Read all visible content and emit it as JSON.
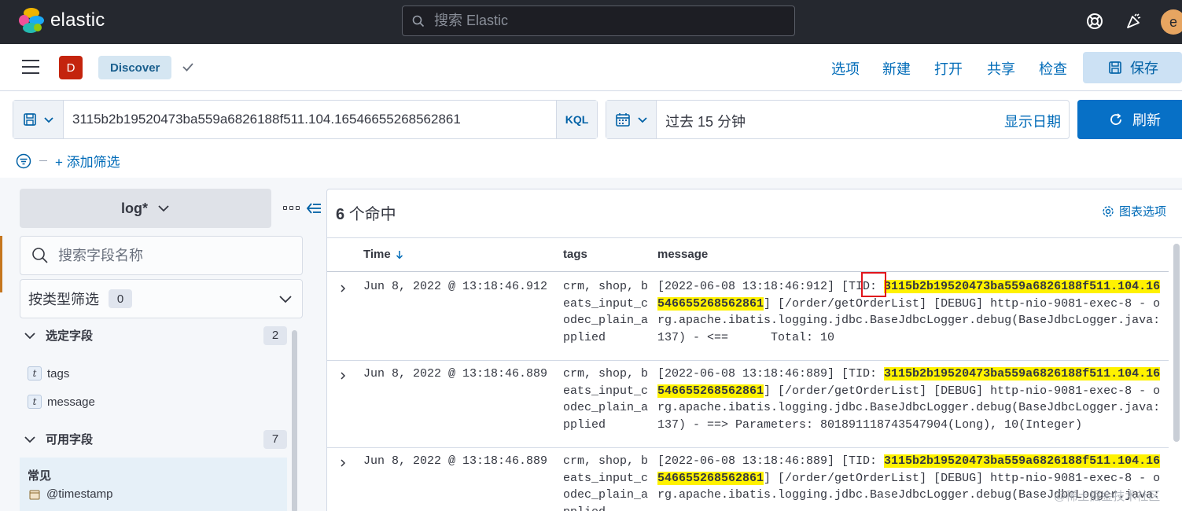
{
  "brand": {
    "name": "elastic"
  },
  "search": {
    "placeholder": "搜索 Elastic"
  },
  "user": {
    "avatar_letter": "e"
  },
  "appbar": {
    "space_letter": "D",
    "breadcrumb": "Discover",
    "nav": [
      "选项",
      "新建",
      "打开",
      "共享",
      "检查"
    ],
    "save_label": "保存"
  },
  "query": {
    "value": "3115b2b19520473ba559a6826188f511.104.16546655268562861",
    "language": "KQL"
  },
  "time": {
    "range": "过去 15 分钟",
    "show_dates": "显示日期",
    "refresh_label": "刷新"
  },
  "filters": {
    "add_label": "+ 添加筛选"
  },
  "sidebar": {
    "index_pattern": "log*",
    "field_search_placeholder": "搜索字段名称",
    "type_filter_label": "按类型筛选",
    "type_filter_count": "0",
    "selected": {
      "title": "选定字段",
      "count": "2",
      "fields": [
        "tags",
        "message"
      ]
    },
    "available": {
      "title": "可用字段",
      "count": "7"
    },
    "common": {
      "title": "常见",
      "fields": [
        "@timestamp"
      ]
    }
  },
  "results": {
    "hits_count": "6",
    "hits_suffix": "个命中",
    "chart_options": "图表选项",
    "columns": [
      "Time",
      "tags",
      "message"
    ],
    "rows": [
      {
        "time": "Jun 8, 2022 @ 13:18:46.912",
        "tags": "crm, shop, beats_input_codec_plain_applied",
        "msg_pre": "[2022-06-08 13:18:46:912] [TID: ",
        "msg_hl": "3115b2b19520473ba559a6826188f511.104.16546655268562861",
        "msg_post": "] [/order/getOrderList] [DEBUG] http-nio-9081-exec-8 - org.apache.ibatis.logging.jdbc.BaseJdbcLogger.debug(BaseJdbcLogger.java:137) - <==      Total: 10"
      },
      {
        "time": "Jun 8, 2022 @ 13:18:46.889",
        "tags": "crm, shop, beats_input_codec_plain_applied",
        "msg_pre": "[2022-06-08 13:18:46:889] [TID: ",
        "msg_hl": "3115b2b19520473ba559a6826188f511.104.16546655268562861",
        "msg_post": "] [/order/getOrderList] [DEBUG] http-nio-9081-exec-8 - org.apache.ibatis.logging.jdbc.BaseJdbcLogger.debug(BaseJdbcLogger.java:137) - ==> Parameters: 801891118743547904(Long), 10(Integer)"
      },
      {
        "time": "Jun 8, 2022 @ 13:18:46.889",
        "tags": "crm, shop, beats_input_codec_plain_applied",
        "msg_pre": "[2022-06-08 13:18:46:889] [TID: ",
        "msg_hl": "3115b2b19520473ba559a6826188f511.104.16546655268562861",
        "msg_post": "] [/order/getOrderList] [DEBUG] http-nio-9081-exec-8 - org.apache.ibatis.logging.jdbc.BaseJdbcLogger.debug(BaseJdbcLogger.java:"
      }
    ]
  },
  "watermark": "@稀土掘金技术社区",
  "colors": {
    "accent": "#0770c6",
    "highlight": "#fff200",
    "topbar": "#25282f",
    "annotation": "#e0141b"
  }
}
